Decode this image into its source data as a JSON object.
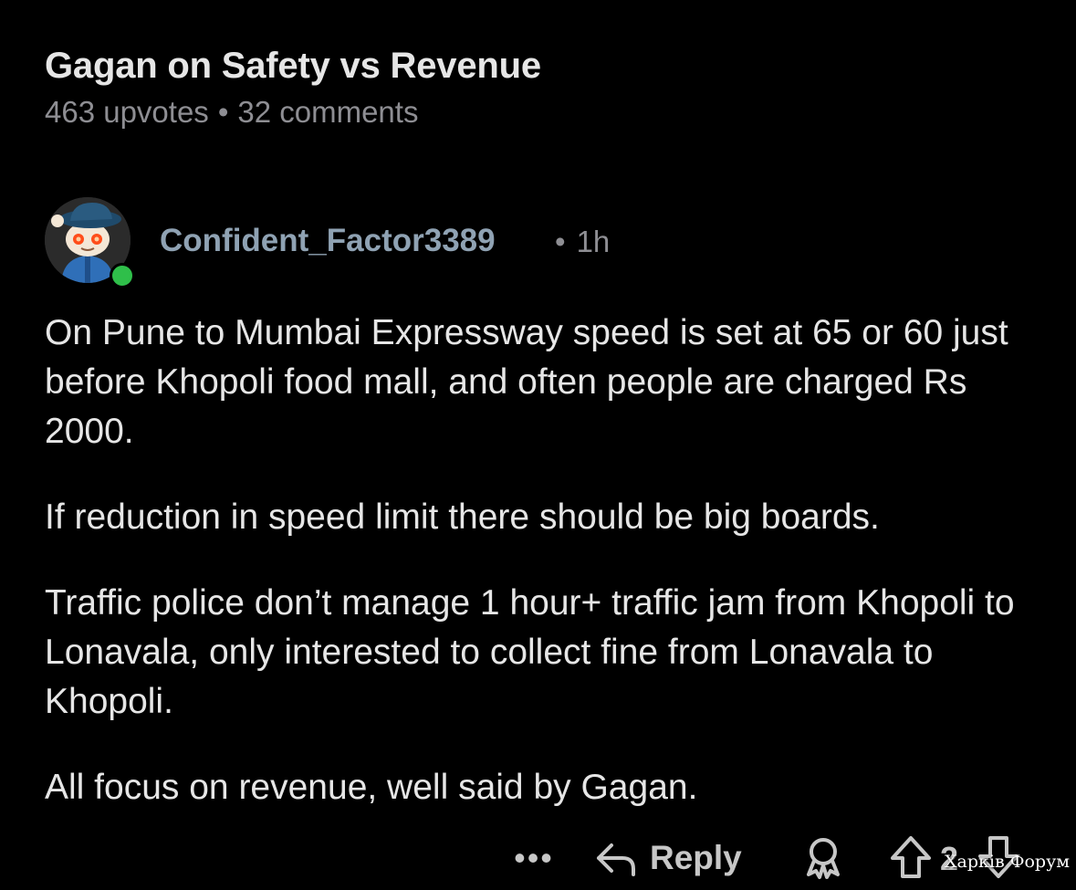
{
  "post": {
    "title": "Gagan on Safety vs Revenue",
    "upvotes": "463 upvotes",
    "separator": "•",
    "comments": "32 comments"
  },
  "comment": {
    "author": "Confident_Factor3389",
    "separator": "•",
    "time": "1h",
    "avatar_icon": "snoo-avatar-icon",
    "online_color": "#2fbf4a",
    "paragraphs": [
      "On Pune to Mumbai Expressway speed is set at 65 or 60 just before Khopoli food mall, and often people are charged Rs 2000.",
      "If reduction in speed limit there should be big boards.",
      "Traffic police don’t manage 1 hour+ traffic jam from Khopoli to Lonavala, only interested to collect fine from Lonavala to Khopoli.",
      "All focus on revenue, well said by Gagan."
    ]
  },
  "actions": {
    "more_label": "•••",
    "reply_label": "Reply",
    "vote_count": "2",
    "icons": [
      "more-icon",
      "reply-arrow-icon",
      "award-icon",
      "upvote-icon",
      "downvote-icon"
    ]
  },
  "watermark": "Харків Форум"
}
